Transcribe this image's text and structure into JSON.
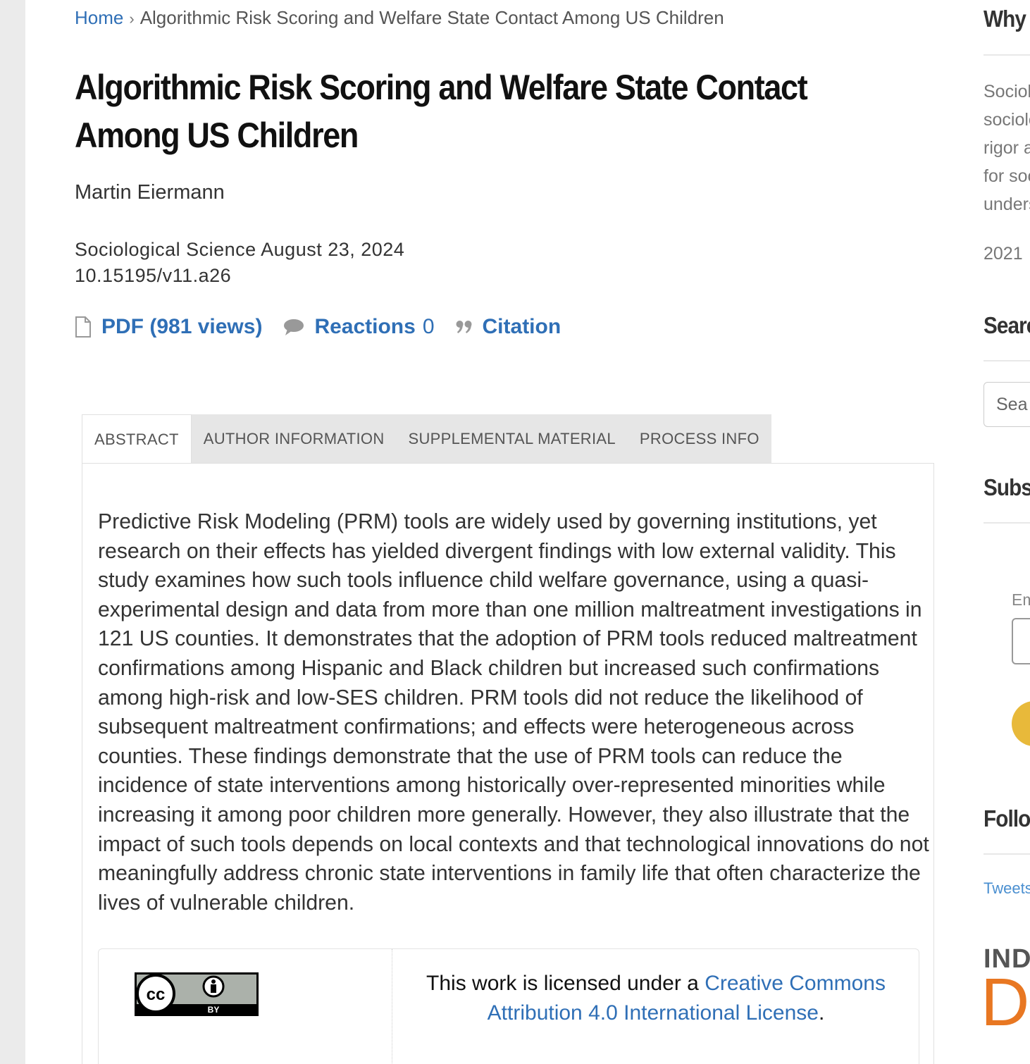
{
  "breadcrumb": {
    "home": "Home",
    "separator": "›",
    "current": "Algorithmic Risk Scoring and Welfare State Contact Among US Children"
  },
  "article": {
    "title": "Algorithmic Risk Scoring and Welfare State Contact Among US Children",
    "author": "Martin Eiermann",
    "journal_date": "Sociological Science August 23, 2024",
    "doi": "10.15195/v11.a26"
  },
  "actions": {
    "pdf_label": "PDF (981 views)",
    "reactions_label": "Reactions",
    "reactions_count": "0",
    "citation_label": "Citation",
    "icons": [
      "document-icon",
      "comment-icon",
      "quote-icon"
    ]
  },
  "tabs": [
    {
      "label": "ABSTRACT",
      "active": true
    },
    {
      "label": "AUTHOR INFORMATION",
      "active": false
    },
    {
      "label": "SUPPLEMENTAL MATERIAL",
      "active": false
    },
    {
      "label": "PROCESS INFO",
      "active": false
    }
  ],
  "abstract": "Predictive Risk Modeling (PRM) tools are widely used by governing institutions, yet research on their effects has yielded divergent findings with low external validity. This study examines how such tools influence child welfare governance, using a quasi-experimental design and data from more than one million maltreatment investigations in 121 US counties. It demonstrates that the adoption of PRM tools reduced maltreatment confirmations among Hispanic and Black children but increased such confirmations among high-risk and low-SES children. PRM tools did not reduce the likelihood of subsequent maltreatment confirmations; and effects were heterogeneous across counties. These findings demonstrate that the use of PRM tools can reduce the incidence of state interventions among historically over-represented minorities while increasing it among poor children more generally. However, they also illustrate that the impact of such tools depends on local contexts and that technological innovations do not meaningfully address chronic state interventions in family life that often characterize the lives of vulnerable children.",
  "license": {
    "badge_text": "BY",
    "prefix": "This work is licensed under a ",
    "link_text": "Creative Commons Attribution 4.0 International License",
    "suffix": "."
  },
  "sidebar": {
    "why_heading": "Why S",
    "why_lines": [
      "Sociol",
      "sociolo",
      "rigor a",
      "for soc",
      "unders"
    ],
    "year": "2021",
    "search_heading": "Searc",
    "search_placeholder": "Sea",
    "subscribe_heading": "Subsc",
    "email_label": "Em",
    "follow_heading": "Follo",
    "tweets_link": "Tweets",
    "logo_line1": "IND",
    "logo_line2": "DO"
  },
  "colors": {
    "link": "#2f6fb6",
    "tab_bg": "#e6e6e6",
    "page_bg": "#ffffff",
    "gutter_bg": "#ebebeb",
    "logo_orange": "#e87722"
  }
}
